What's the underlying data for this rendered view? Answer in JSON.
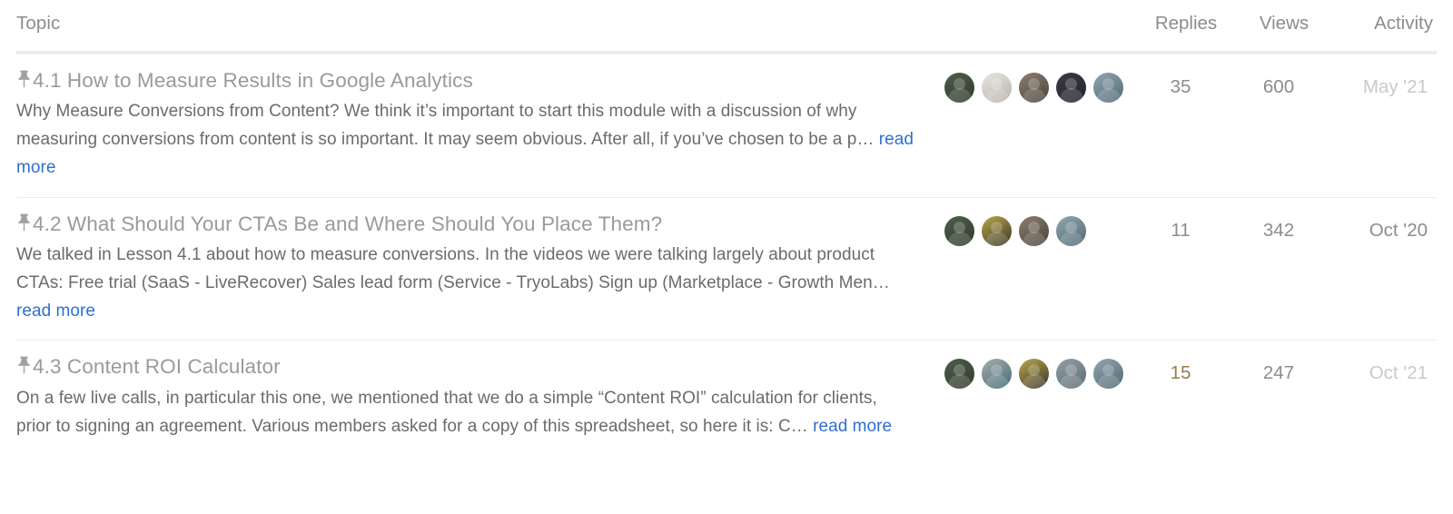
{
  "header": {
    "topic_label": "Topic",
    "replies_label": "Replies",
    "views_label": "Views",
    "activity_label": "Activity"
  },
  "colors": {
    "muted_text": "#8c8c8c",
    "title_text": "#9a9a9a",
    "excerpt_text": "#6b6b6b",
    "link_blue": "#2f6fd0",
    "unread_gold": "#9a7a4a",
    "faded_date": "#c9c9c9",
    "row_divider": "#eeeeee",
    "header_rule": "#ececec"
  },
  "read_more_label": "read more",
  "pin_icon": "pin-icon",
  "topics": [
    {
      "pinned": true,
      "title": "4.1 How to Measure Results in Google Analytics",
      "excerpt": "Why Measure Conversions from Content? We think it’s important to start this module with a discussion of why measuring conversions from content is so important. It may seem obvious. After all, if you’ve chosen to be a p… ",
      "replies": "35",
      "views": "600",
      "activity": "May '21",
      "activity_faded": true,
      "replies_unread": false,
      "avatars": [
        {
          "name": "avatar-participant-1",
          "colors": [
            "#4e5f4a",
            "#2f3a2c"
          ]
        },
        {
          "name": "avatar-participant-2",
          "colors": [
            "#e6e6e2",
            "#b9b3a6"
          ]
        },
        {
          "name": "avatar-participant-3",
          "colors": [
            "#8d7f72",
            "#4a4038"
          ]
        },
        {
          "name": "avatar-participant-4",
          "colors": [
            "#3e3a44",
            "#20242e"
          ]
        },
        {
          "name": "avatar-participant-5",
          "colors": [
            "#93a6ae",
            "#4f6874"
          ]
        }
      ]
    },
    {
      "pinned": true,
      "title": "4.2 What Should Your CTAs Be and Where Should You Place Them?",
      "excerpt": "We talked in Lesson 4.1 about how to measure conversions. In the videos we were talking largely about product CTAs: Free trial (SaaS - LiveRecover) Sales lead form (Service - TryoLabs) Sign up (Marketplace - Growth Men… ",
      "replies": "11",
      "views": "342",
      "activity": "Oct '20",
      "activity_faded": false,
      "replies_unread": false,
      "avatars": [
        {
          "name": "avatar-participant-1",
          "colors": [
            "#4e5f4a",
            "#2f3a2c"
          ]
        },
        {
          "name": "avatar-participant-2",
          "colors": [
            "#b9a84b",
            "#3a3428"
          ]
        },
        {
          "name": "avatar-participant-3",
          "colors": [
            "#8d7f72",
            "#4a4038"
          ]
        },
        {
          "name": "avatar-participant-4",
          "colors": [
            "#93a6ae",
            "#4f6874"
          ]
        }
      ]
    },
    {
      "pinned": true,
      "title": "4.3 Content ROI Calculator",
      "excerpt": "On a few live calls, in particular this one, we mentioned that we do a simple “Content ROI” calculation for clients, prior to signing an agreement. Various members asked for a copy of this spreadsheet, so here it is: C… ",
      "replies": "15",
      "views": "247",
      "activity": "Oct '21",
      "activity_faded": true,
      "replies_unread": true,
      "avatars": [
        {
          "name": "avatar-participant-1",
          "colors": [
            "#4e5f4a",
            "#2f3a2c"
          ]
        },
        {
          "name": "avatar-participant-2",
          "colors": [
            "#a9adb0",
            "#3f6a72"
          ]
        },
        {
          "name": "avatar-participant-3",
          "colors": [
            "#b9a84b",
            "#3a3428"
          ]
        },
        {
          "name": "avatar-participant-4",
          "colors": [
            "#93a0a6",
            "#5b6b72"
          ]
        },
        {
          "name": "avatar-participant-5",
          "colors": [
            "#93a6ae",
            "#4f6874"
          ]
        }
      ]
    }
  ]
}
